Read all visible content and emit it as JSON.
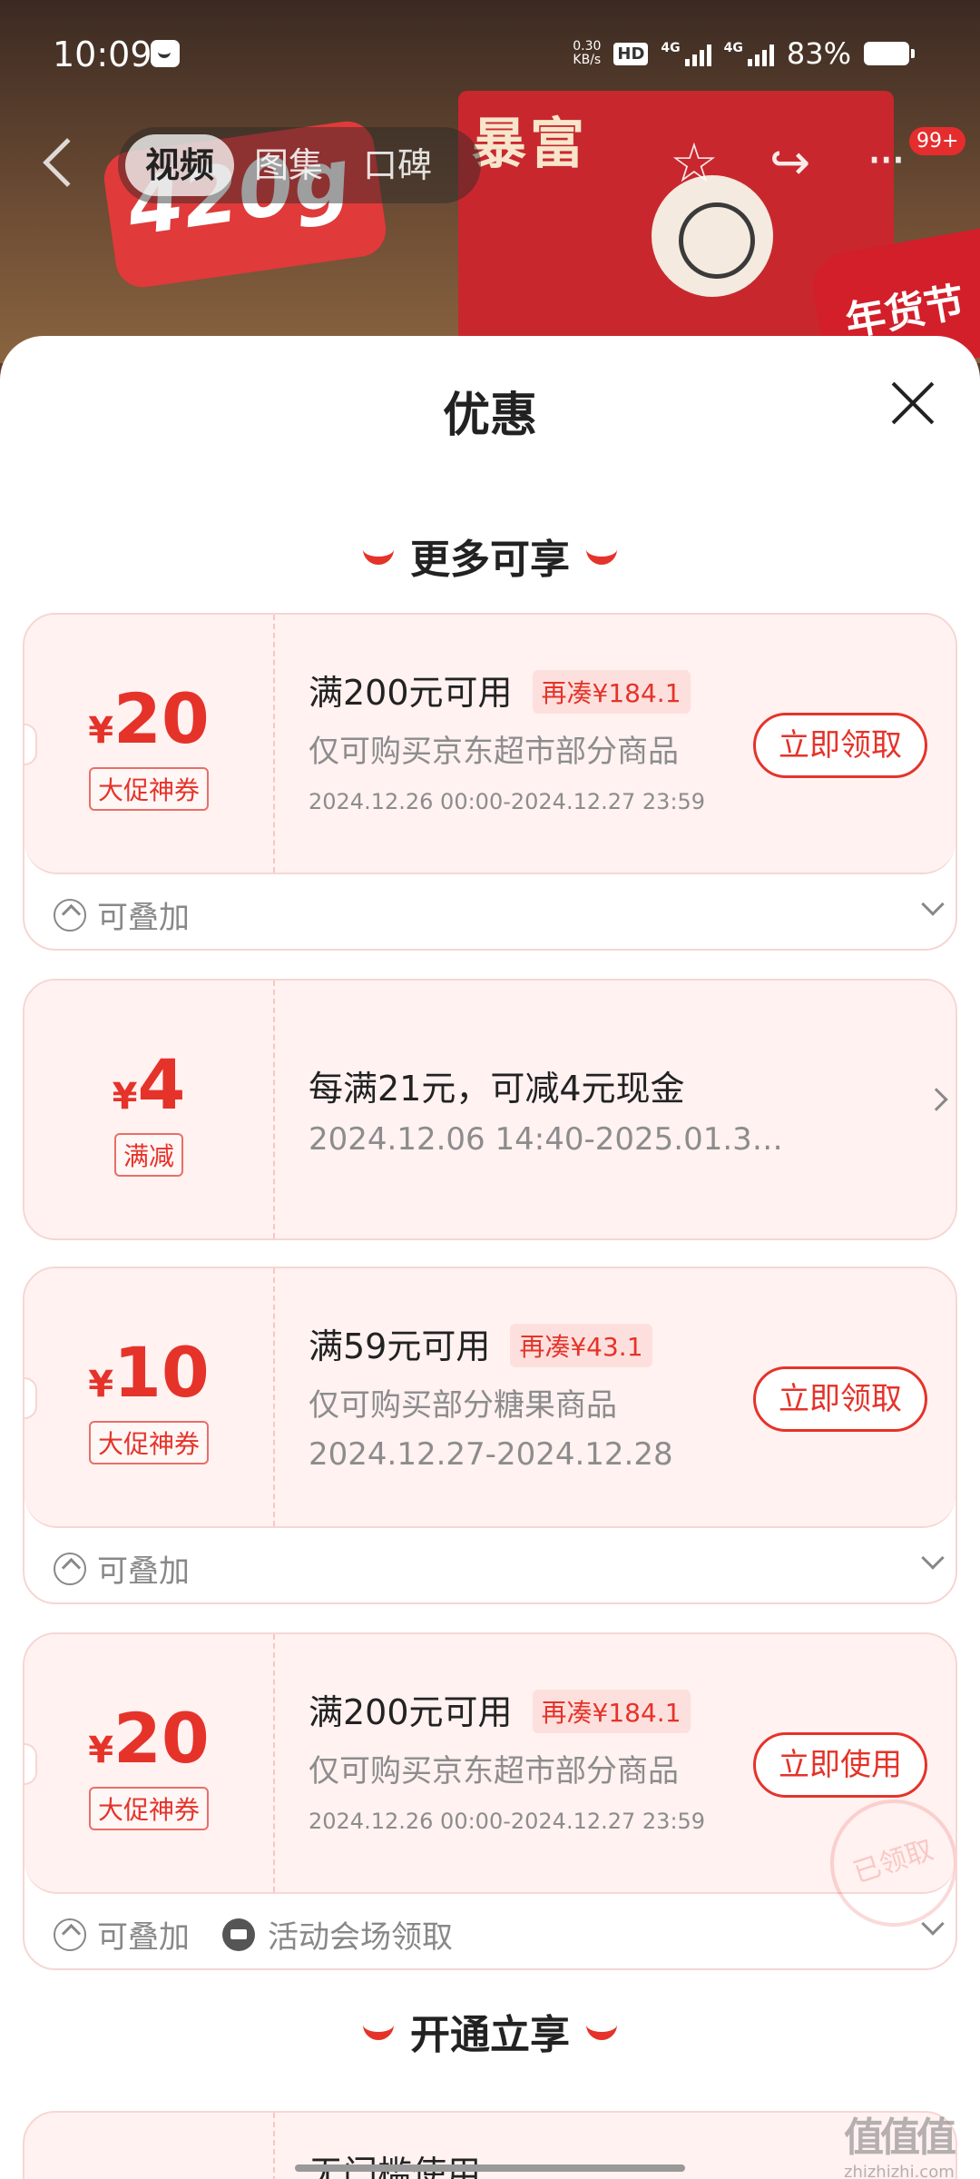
{
  "status_bar": {
    "time": "10:09",
    "net_speed_value": "0.30",
    "net_speed_unit": "KB/s",
    "hd_label": "HD",
    "sim1_label": "4G",
    "sim2_label": "4G",
    "battery_percent": "83%"
  },
  "product_header": {
    "tabs": [
      "视频",
      "图集",
      "口碑"
    ],
    "active_tab": "视频",
    "more_badge": "99+",
    "hero_overlay_texts": [
      "420g",
      "暴富",
      "年货节"
    ]
  },
  "sheet": {
    "title": "优惠",
    "section_more": "更多可享",
    "section_open": "开通立享"
  },
  "coupons": [
    {
      "currency": "¥",
      "amount": "20",
      "tag": "大促神券",
      "condition": "满200元可用",
      "gap": "再凑¥184.1",
      "description": "仅可购买京东超市部分商品",
      "date": "2024.12.26 00:00-2024.12.27 23:59",
      "button": "立即领取",
      "stack_label": "可叠加"
    },
    {
      "currency": "¥",
      "amount": "4",
      "tag": "满减",
      "condition": "每满21元，可减4元现金",
      "date": "2024.12.06 14:40-2025.01.3…"
    },
    {
      "currency": "¥",
      "amount": "10",
      "tag": "大促神券",
      "condition": "满59元可用",
      "gap": "再凑¥43.1",
      "description": "仅可购买部分糖果商品",
      "date": "2024.12.27-2024.12.28",
      "button": "立即领取",
      "stack_label": "可叠加"
    },
    {
      "currency": "¥",
      "amount": "20",
      "tag": "大促神券",
      "condition": "满200元可用",
      "gap": "再凑¥184.1",
      "description": "仅可购买京东超市部分商品",
      "date": "2024.12.26 00:00-2024.12.27 23:59",
      "button": "立即使用",
      "stack_label": "可叠加",
      "venue_label": "活动会场领取",
      "stamp": "已领取"
    }
  ],
  "bottom_partial": "无门槛使用",
  "watermark": {
    "mark": "值值值",
    "site": "zhizhizhi.com"
  },
  "colors": {
    "accent_red": "#e5332a",
    "card_bg": "#fff2f1",
    "card_border": "#f6d6d3",
    "muted_text": "#8c8c8c"
  }
}
